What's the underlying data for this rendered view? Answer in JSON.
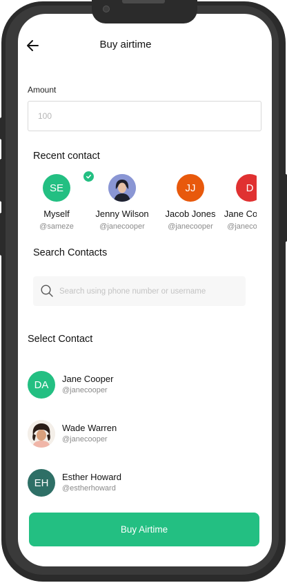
{
  "header": {
    "title": "Buy airtime"
  },
  "amount": {
    "label": "Amount",
    "placeholder": "100"
  },
  "recent": {
    "heading": "Recent contact",
    "contacts": [
      {
        "initials": "SE",
        "name": "Myself",
        "handle": "@sameze",
        "color": "#23bf82",
        "selected": true
      },
      {
        "initials": "",
        "name": "Jenny Wilson",
        "handle": "@janecooper",
        "photo": true
      },
      {
        "initials": "JJ",
        "name": "Jacob Jones",
        "handle": "@janecooper",
        "color": "#e8590c"
      },
      {
        "initials": "D",
        "name": "Jane Cooper",
        "handle": "@janecooper",
        "color": "#e03131"
      }
    ]
  },
  "search": {
    "heading": "Search Contacts",
    "placeholder": "Search using phone number or username",
    "icon": "search-icon"
  },
  "select": {
    "heading": "Select Contact",
    "items": [
      {
        "initials": "DA",
        "name": "Jane Cooper",
        "handle": "@janecooper",
        "color": "#23bf82"
      },
      {
        "initials": "",
        "name": "Wade Warren",
        "handle": "@janecooper",
        "photo": true
      },
      {
        "initials": "EH",
        "name": "Esther Howard",
        "handle": "@estherhoward",
        "color": "#2e6f66"
      }
    ]
  },
  "cta": {
    "label": "Buy Airtime",
    "color": "#23bf82"
  }
}
